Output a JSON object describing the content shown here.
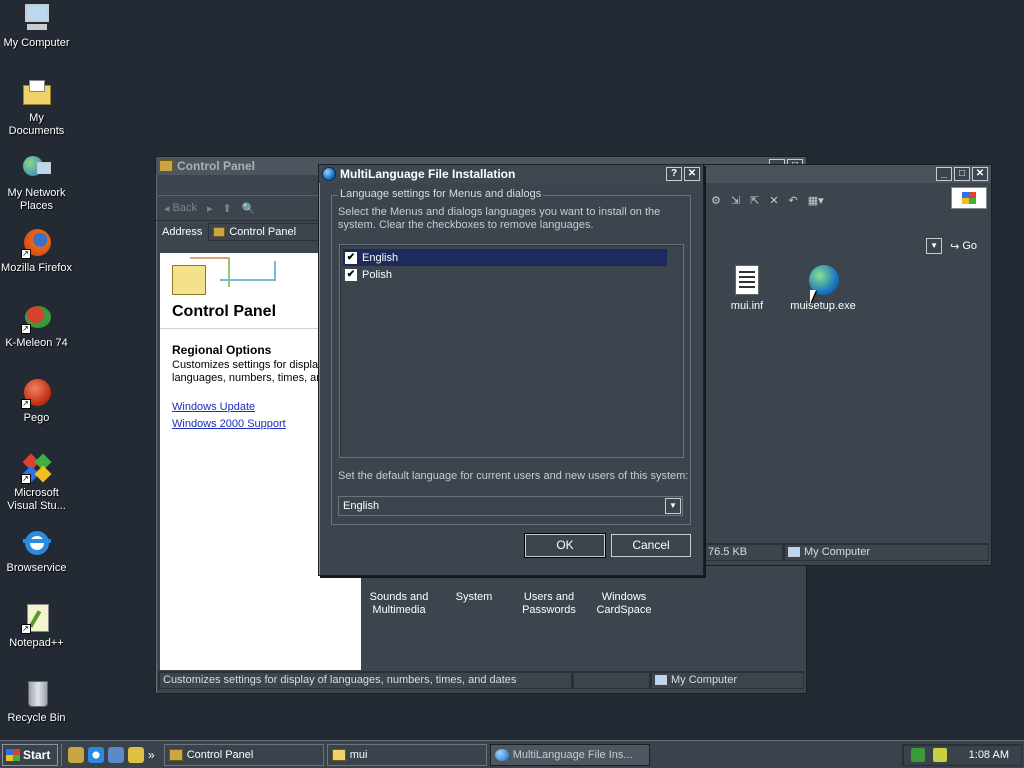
{
  "desktop": {
    "icons": [
      {
        "label": "My Computer",
        "icon": "computer-icon"
      },
      {
        "label": "My Documents",
        "icon": "folder-icon"
      },
      {
        "label": "My Network Places",
        "icon": "network-icon"
      },
      {
        "label": "Mozilla Firefox",
        "icon": "firefox-icon"
      },
      {
        "label": "K-Meleon 74",
        "icon": "kmeleon-icon"
      },
      {
        "label": "Pego",
        "icon": "pego-icon"
      },
      {
        "label": "Microsoft Visual Stu...",
        "icon": "visual-studio-icon"
      },
      {
        "label": "Browservice",
        "icon": "ie-icon"
      },
      {
        "label": "Notepad++",
        "icon": "notepadpp-icon"
      },
      {
        "label": "Recycle Bin",
        "icon": "recycle-bin-icon"
      }
    ]
  },
  "control_panel": {
    "title": "Control Panel",
    "toolbar_back": "Back",
    "address_label": "Address",
    "address_value": "Control Panel",
    "heading": "Control Panel",
    "section_title": "Regional Options",
    "section_desc_1": "Customizes settings for display",
    "section_desc_2": "languages, numbers, times, an",
    "links": [
      "Windows Update",
      "Windows 2000 Support"
    ],
    "items": [
      "Sounds and Multimedia",
      "System",
      "Users and Passwords",
      "Windows CardSpace"
    ],
    "status_text": "Customizes settings for display of languages, numbers, times, and dates",
    "status_location": "My Computer"
  },
  "mui_window": {
    "address_go": "Go",
    "files": [
      {
        "name": "mui.inf",
        "icon": "inf-file-icon"
      },
      {
        "name": "muisetup.exe",
        "icon": "setup-exe-icon"
      }
    ],
    "status_size": "76.5 KB",
    "status_location": "My Computer"
  },
  "dialog": {
    "title": "MultiLanguage File Installation",
    "help_btn": "?",
    "close_btn": "✕",
    "group_title": "Language settings for Menus and dialogs",
    "description": "Select the Menus and dialogs languages you want to install on the system. Clear the checkboxes to remove languages.",
    "languages": [
      {
        "name": "English",
        "checked": true,
        "selected": true
      },
      {
        "name": "Polish",
        "checked": true,
        "selected": false
      }
    ],
    "default_label": "Set the default language for current users and new users of this system:",
    "default_value": "English",
    "ok_label": "OK",
    "cancel_label": "Cancel"
  },
  "taskbar": {
    "start_label": "Start",
    "tasks": [
      {
        "label": "Control Panel",
        "active": false
      },
      {
        "label": "mui",
        "active": false
      },
      {
        "label": "MultiLanguage File Ins...",
        "active": true
      }
    ],
    "clock": "1:08 AM",
    "more_arrow": "»"
  }
}
